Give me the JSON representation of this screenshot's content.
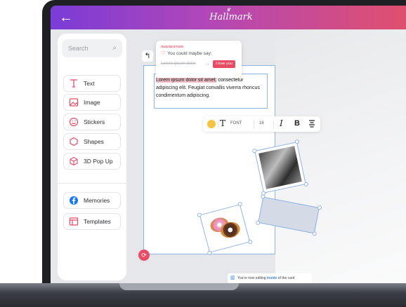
{
  "topbar": {
    "brand": "Hallmark",
    "back_icon": "arrow-left-icon"
  },
  "search": {
    "placeholder": "Search"
  },
  "tools": [
    {
      "label": "Text",
      "icon": "text-icon"
    },
    {
      "label": "Image",
      "icon": "image-icon"
    },
    {
      "label": "Stickers",
      "icon": "smiley-icon"
    },
    {
      "label": "Shapes",
      "icon": "hexagon-icon"
    },
    {
      "label": "3D Pop Up",
      "icon": "cube-icon"
    }
  ],
  "extras": [
    {
      "label": "Memories",
      "icon": "facebook-icon"
    },
    {
      "label": "Templates",
      "icon": "template-icon"
    }
  ],
  "suggestion": {
    "label": "SUGGESTION",
    "prompt": "You could maybe say:",
    "original": "Lorem ipsum dolor",
    "replacement": "I love you"
  },
  "textbox": {
    "highlighted": "Lorem ipsum dolor sit amet,",
    "rest": " consectetur adipiscing elit. Feugiat convallis viverra rhoncus condimentum adipiscing."
  },
  "format_toolbar": {
    "color": "#f6c342",
    "font_label": "FONT",
    "size": "16",
    "italic": "I",
    "bold": "B"
  },
  "footer_note": {
    "pre": "You're now editing ",
    "em": "inside",
    "post": " of the card"
  },
  "colors": {
    "accent": "#ea4b64",
    "brand_start": "#7a3bd6",
    "brand_end": "#e04f6e",
    "selection": "#8fb4e8"
  }
}
